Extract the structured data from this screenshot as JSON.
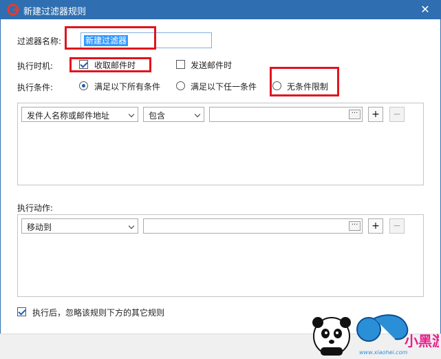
{
  "window": {
    "title": "新建过滤器规则",
    "logo_icon": "app-logo-icon",
    "close_icon": "close-icon"
  },
  "form": {
    "name_label": "过滤器名称:",
    "name_value": "新建过滤器",
    "timing_label": "执行时机:",
    "timing_options": [
      {
        "label": "收取邮件时",
        "checked": true
      },
      {
        "label": "发送邮件时",
        "checked": false
      }
    ],
    "condition_label": "执行条件:",
    "condition_options": [
      {
        "label": "满足以下所有条件",
        "selected": true
      },
      {
        "label": "满足以下任一条件",
        "selected": false
      },
      {
        "label": "无条件限制",
        "selected": false
      }
    ],
    "condition_rule": {
      "field": "发件人名称或邮件地址",
      "operator": "包含",
      "value": ""
    },
    "action_label": "执行动作:",
    "action_rule": {
      "action": "移动到",
      "value": ""
    },
    "ignore_label": "执行后，忽略该规则下方的其它规则",
    "ignore_checked": true,
    "browse_label": "···",
    "add_label": "+",
    "remove_label": "−"
  },
  "watermark": {
    "text": "小黑游戏",
    "url": "www.xiaohei.com"
  },
  "colors": {
    "titlebar": "#2f6fb1",
    "highlight": "#e0141e",
    "selection": "#3399ff"
  }
}
